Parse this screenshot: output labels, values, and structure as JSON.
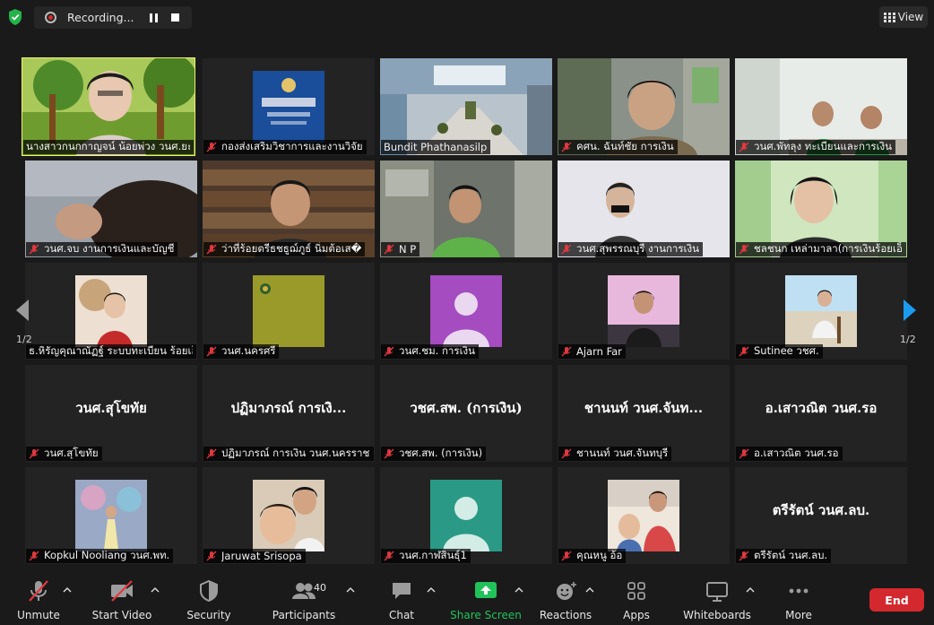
{
  "recording": {
    "label": "Recording..."
  },
  "view": {
    "label": "View"
  },
  "pager": {
    "left": "1/2",
    "right": "1/2"
  },
  "tiles": [
    {
      "name": "นางสาวกนกกาญจน์ น้อยพ่วง วนศ.ยะลา",
      "muted": false
    },
    {
      "name": "กองส่งเสริมวิชาการและงานวิจัย",
      "muted": true
    },
    {
      "name": "Bundit Phathanasilp",
      "muted": false
    },
    {
      "name": "คศน. ฉันท์ชัย การเงิน",
      "muted": true
    },
    {
      "name": "วนศ.พัทลุง ทะเบียนและการเงิน",
      "muted": true
    },
    {
      "name": "วนศ.จบ งานการเงินและบัญชี",
      "muted": true
    },
    {
      "name": "ว่าที่ร้อยตรีธชธูฌ์ภูธ์ นิ่มต้อเส�",
      "muted": true
    },
    {
      "name": "N P",
      "muted": true
    },
    {
      "name": "วนศ.สุพรรณบุรี งานการเงิน",
      "muted": true
    },
    {
      "name": "ชลชนก เหล่ามาลา(การเงินร้อยเอ็ด)",
      "muted": true
    },
    {
      "name": "ธ.หิรัญคุณาณัฏฐ์ ระบบทะเบียน ร้อยเอ็ด",
      "muted": false
    },
    {
      "name": "วนศ.นครศรี",
      "muted": true
    },
    {
      "name": "วนศ.ชม. การเงิน",
      "muted": true
    },
    {
      "name": "Ajarn Far",
      "muted": true
    },
    {
      "name": "Sutinee วชศ.",
      "muted": true
    },
    {
      "name": "วนศ.สุโขทัย",
      "muted": true,
      "card": "วนศ.สุโขทัย"
    },
    {
      "name": "ปฏิมาภรณ์ การเงิน วนศ.นครราชสีมา",
      "muted": true,
      "card": "ปฏิมาภรณ์ การเงิ..."
    },
    {
      "name": "วชศ.สพ. (การเงิน)",
      "muted": true,
      "card": "วชศ.สพ. (การเงิน)"
    },
    {
      "name": "ชานนท์ วนศ.จันทบุรี",
      "muted": true,
      "card": "ชานนท์ วนศ.จันท..."
    },
    {
      "name": "อ.เสาวณิต วนศ.รอ",
      "muted": true,
      "card": "อ.เสาวณิต วนศ.รอ"
    },
    {
      "name": "Kopkul Nooliang วนศ.พท.",
      "muted": true
    },
    {
      "name": "Jaruwat Srisopa",
      "muted": true
    },
    {
      "name": "วนศ.กาฬสินธุ์1",
      "muted": true
    },
    {
      "name": "คุณหนู อ้อ",
      "muted": true
    },
    {
      "name": "ตรีรัตน์ วนศ.ลบ.",
      "muted": true,
      "card": "ตรีรัตน์ วนศ.ลบ."
    }
  ],
  "toolbar": {
    "unmute": "Unmute",
    "start_video": "Start Video",
    "security": "Security",
    "participants": "Participants",
    "participants_count": "40",
    "chat": "Chat",
    "share_screen": "Share Screen",
    "reactions": "Reactions",
    "apps": "Apps",
    "whiteboards": "Whiteboards",
    "more": "More",
    "end": "End"
  },
  "colors": {
    "speaker_border": "#f0f06a",
    "share_green": "#22c25a",
    "end_red": "#d3292e",
    "mute_red": "#e0383e"
  }
}
